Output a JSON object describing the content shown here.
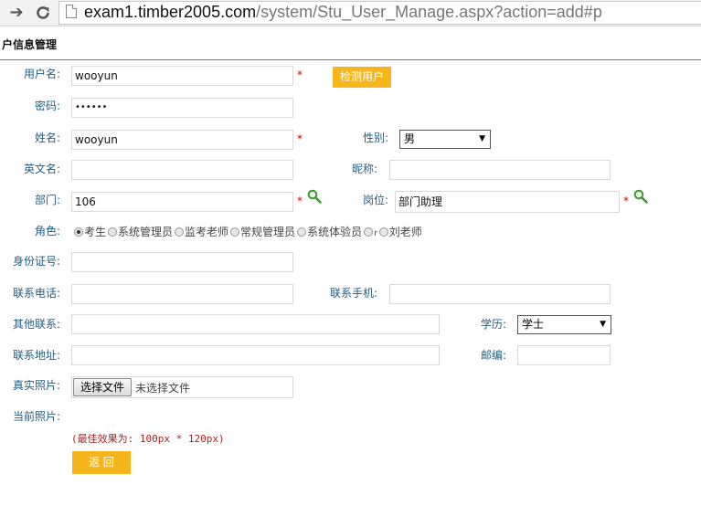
{
  "browser": {
    "back_icon": "arrow-right-icon",
    "reload_icon": "reload-icon",
    "url_host": "exam1.timber2005.com",
    "url_rest": "/system/Stu_User_Manage.aspx?action=add#p"
  },
  "page": {
    "title": "户信息管理"
  },
  "form": {
    "username": {
      "label": "用户名:",
      "value": "wooyun",
      "required": "*",
      "check_button": "检测用户"
    },
    "password": {
      "label": "密码:",
      "value": "••••••"
    },
    "name": {
      "label": "姓名:",
      "value": "wooyun",
      "required": "*"
    },
    "gender": {
      "label": "性别:",
      "selected": "男"
    },
    "english_name": {
      "label": "英文名:",
      "value": ""
    },
    "nickname": {
      "label": "昵称:",
      "value": ""
    },
    "department": {
      "label": "部门:",
      "value": "106",
      "required": "*"
    },
    "position": {
      "label": "岗位:",
      "value": "部门助理",
      "required": "*"
    },
    "role": {
      "label": "角色:",
      "options": [
        "考生",
        "系统管理员",
        "监考老师",
        "常规管理员",
        "系统体验员",
        "r",
        "刘老师"
      ],
      "selected": "考生"
    },
    "id_card": {
      "label": "身份证号:",
      "value": ""
    },
    "phone": {
      "label": "联系电话:",
      "value": ""
    },
    "mobile": {
      "label": "联系手机:",
      "value": ""
    },
    "other_contact": {
      "label": "其他联系:",
      "value": ""
    },
    "education": {
      "label": "学历:",
      "selected": "学士"
    },
    "address": {
      "label": "联系地址:",
      "value": ""
    },
    "postcode": {
      "label": "邮编:",
      "value": ""
    },
    "photo": {
      "label": "真实照片:",
      "choose_button": "选择文件",
      "no_file": "未选择文件"
    },
    "current_photo": {
      "label": "当前照片:"
    },
    "note": "(最佳效果为: 100px * 120px)",
    "back_button": "返 回"
  }
}
